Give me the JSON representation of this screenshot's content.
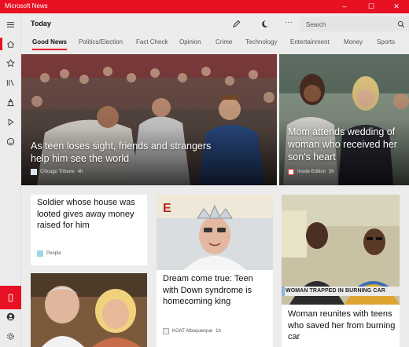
{
  "app": {
    "title": "Microsoft News"
  },
  "window_controls": {
    "minimize": "–",
    "maximize": "☐",
    "close": "✕"
  },
  "header": {
    "title": "Today",
    "more": "···",
    "search_placeholder": "Search"
  },
  "tabs": [
    "Good News",
    "Politics/Election",
    "Fact Check",
    "Opinion",
    "Crime",
    "Technology",
    "Entertainment",
    "Money",
    "Sports"
  ],
  "hero": [
    {
      "title": "As teen loses sight, friends and strangers help him see the world",
      "source": "Chicago Tribune",
      "age": "4h"
    },
    {
      "title": "Mom attends wedding of woman who received her son's heart",
      "source": "Inside Edition",
      "age": "3h"
    }
  ],
  "cards": [
    {
      "title": "Soldier whose house was looted gives away money raised for him",
      "source": "People",
      "age": ""
    },
    {
      "title": "Dream come true: Teen with Down syndrome is homecoming king",
      "source": "KOAT Albuquerque",
      "age": "1h"
    },
    {
      "title": "Woman reunites with teens who saved her from burning car",
      "source": "",
      "age": ""
    }
  ],
  "video_chyron": "WOMAN TRAPPED IN BURNING CAR",
  "colors": {
    "accent": "#e81123",
    "background": "#ececec",
    "card": "#ffffff"
  }
}
